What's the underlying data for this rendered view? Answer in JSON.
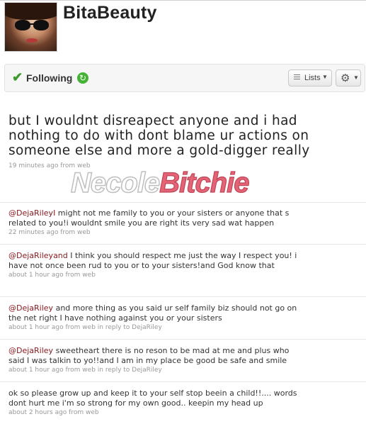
{
  "profile": {
    "screen_name": "BitaBeauty"
  },
  "actions": {
    "following_label": "Following",
    "lists_label": "Lists"
  },
  "main_tweet": {
    "text": "but I wouldnt disreapect anyone and i had nothing to do with dont blame ur actions on someone else and more a gold-digger really",
    "time": "19 minutes ago from web"
  },
  "watermark": {
    "part1": "Necole",
    "part2": "Bitchie"
  },
  "tweets": [
    {
      "mention": "@DejaRileyI",
      "text": " might not me family to you or your sisters or anyone that s related to you!i wouldnt smile you are right its very sad wat happen",
      "meta": "22 minutes ago from web"
    },
    {
      "mention": "@DejaRileyand",
      "text": " I think you should respect me just the way I respect you! i have not once been rud to you or to your sisters!and God know that",
      "meta": "about 1 hour ago from web"
    },
    {
      "mention": "@DejaRiley",
      "text": " and more thing as you said ur self family biz should not go on the net right I have nothing against you or your sisters",
      "meta": "about 1 hour ago from web in reply to DejaRiley"
    },
    {
      "mention": "@DejaRiley",
      "text": " sweetheart there is no reson to be mad at me and plus who said I was talkin to yo!!and I am in my place be good be safe and smile",
      "meta": "about 1 hour ago from web in reply to DejaRiley"
    },
    {
      "mention": "",
      "text": "ok so please grow up and keep it to your self stop beein a child!!.... words dont hurt me i'm so strong for my own good.. keepin my head up",
      "meta": "about 2 hours ago from web"
    }
  ]
}
